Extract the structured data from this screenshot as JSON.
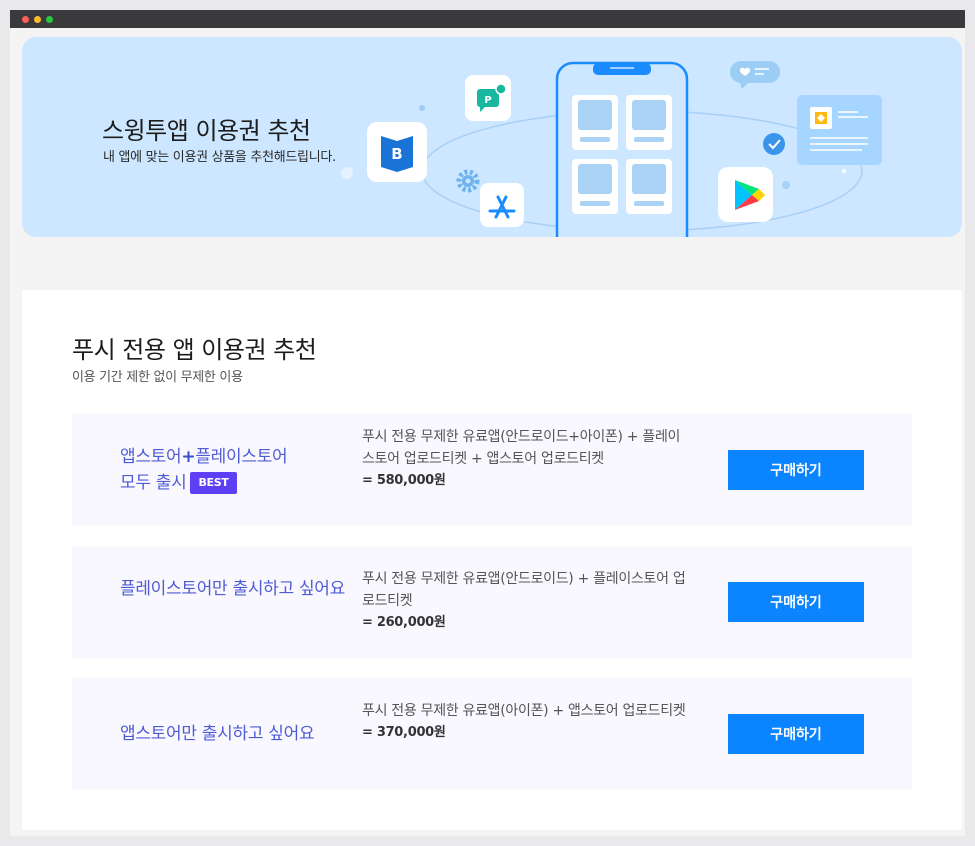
{
  "banner": {
    "title": "스윙투앱 이용권 추천",
    "subtitle": "내 앱에 맞는 이용권 상품을 추천해드립니다."
  },
  "section": {
    "title": "푸시 전용 앱 이용권 추천",
    "subtitle": "이용 기간 제한 없이 무제한 이용"
  },
  "plans": [
    {
      "name_part1": "앱스토어",
      "name_plus": "+",
      "name_part2": "플레이스토어",
      "name_line2": "모두 출시",
      "badge": "BEST",
      "desc": "푸시 전용 무제한 유료앱(안드로이드+아이폰) + 플레이스토어 업로드티켓 + 앱스토어 업로드티켓",
      "price": "= 580,000원",
      "button": "구매하기"
    },
    {
      "name": "플레이스토어만 출시하고 싶어요",
      "desc": "푸시 전용 무제한 유료앱(안드로이드) + 플레이스토어 업로드티켓",
      "price": "= 260,000원",
      "button": "구매하기"
    },
    {
      "name": "앱스토어만 출시하고 싶어요",
      "desc": "푸시 전용 무제한 유료앱(아이폰) + 앱스토어 업로드티켓",
      "price": "= 370,000원",
      "button": "구매하기"
    }
  ],
  "icons": [
    "blogger-b-icon",
    "parking-p-icon",
    "gear-icon",
    "app-store-icon",
    "phone-icon",
    "chat-heart-icon",
    "id-card-icon",
    "check-icon",
    "google-play-icon"
  ],
  "colors": {
    "banner_bg": "#cce7ff",
    "button": "#0a84ff",
    "plan_name": "#4f5bd5",
    "best_badge": "#5e3ff5"
  }
}
